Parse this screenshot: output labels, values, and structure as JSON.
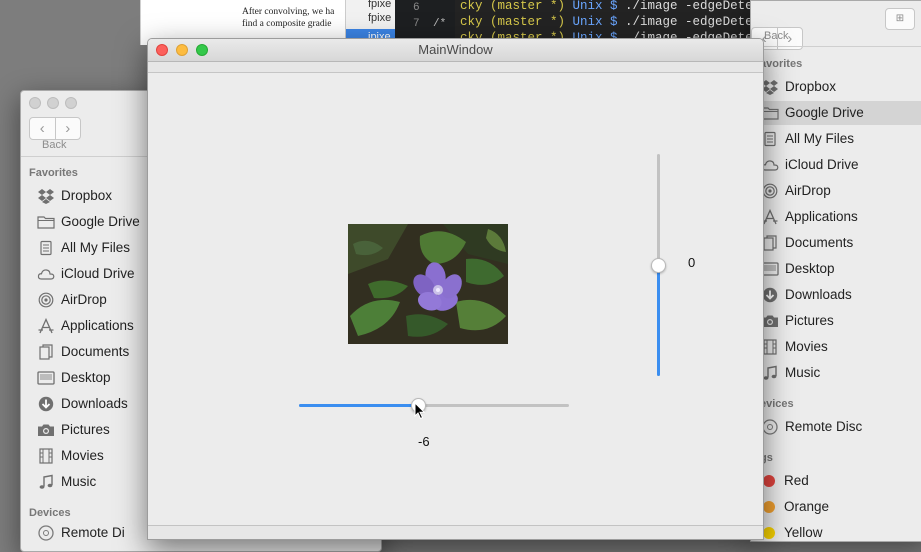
{
  "background": {
    "doc_lines": [
      "After convolving, we ha",
      "find a composite gradie"
    ],
    "ide_rows": [
      "fpixe",
      "fpixe",
      "ipixe"
    ],
    "gutter": [
      "6",
      "7"
    ],
    "terminal_lines": [
      {
        "a": "cky ",
        "b": "(master *) ",
        "c": "Unix $ ",
        "d": "./image -edgeDetect"
      },
      {
        "a": "cky ",
        "b": "(master *) ",
        "c": "Unix $ ",
        "d": "./image -edgeDetect"
      },
      {
        "a": "cky ",
        "b": "(master *) ",
        "c": "Unix $ ",
        "d": "./image -edgeDetect"
      }
    ]
  },
  "finder_left": {
    "back_label": "Back",
    "favorites_header": "Favorites",
    "items": [
      {
        "label": "Dropbox",
        "icon": "dropbox-icon"
      },
      {
        "label": "Google Drive",
        "icon": "folder-icon"
      },
      {
        "label": "All My Files",
        "icon": "all-files-icon"
      },
      {
        "label": "iCloud Drive",
        "icon": "cloud-icon"
      },
      {
        "label": "AirDrop",
        "icon": "airdrop-icon"
      },
      {
        "label": "Applications",
        "icon": "applications-icon"
      },
      {
        "label": "Documents",
        "icon": "documents-icon"
      },
      {
        "label": "Desktop",
        "icon": "desktop-icon"
      },
      {
        "label": "Downloads",
        "icon": "downloads-icon"
      },
      {
        "label": "Pictures",
        "icon": "camera-icon"
      },
      {
        "label": "Movies",
        "icon": "film-icon"
      },
      {
        "label": "Music",
        "icon": "music-icon"
      }
    ],
    "devices_header": "Devices",
    "devices_partial": "Remote Di"
  },
  "finder_right": {
    "back_label": "Back",
    "favorites_header": "avorites",
    "items": [
      {
        "label": "Dropbox",
        "icon": "dropbox-icon"
      },
      {
        "label": "Google Drive",
        "icon": "folder-icon",
        "selected": true
      },
      {
        "label": "All My Files",
        "icon": "all-files-icon"
      },
      {
        "label": "iCloud Drive",
        "icon": "cloud-icon"
      },
      {
        "label": "AirDrop",
        "icon": "airdrop-icon"
      },
      {
        "label": "Applications",
        "icon": "applications-icon"
      },
      {
        "label": "Documents",
        "icon": "documents-icon"
      },
      {
        "label": "Desktop",
        "icon": "desktop-icon"
      },
      {
        "label": "Downloads",
        "icon": "downloads-icon"
      },
      {
        "label": "Pictures",
        "icon": "camera-icon"
      },
      {
        "label": "Movies",
        "icon": "film-icon"
      },
      {
        "label": "Music",
        "icon": "music-icon"
      }
    ],
    "devices_header": "evices",
    "device_item": "Remote Disc",
    "tags_header": "gs",
    "tags": [
      {
        "label": "Red",
        "color": "#e0443e"
      },
      {
        "label": "Orange",
        "color": "#f0a030"
      },
      {
        "label": "Yellow",
        "color": "#f5d000"
      }
    ]
  },
  "main_window": {
    "title": "MainWindow",
    "h_slider": {
      "value": -6,
      "fraction": 0.44,
      "label": "-6"
    },
    "v_slider": {
      "value": 0,
      "fraction": 0.5,
      "label": "0"
    },
    "accent_color": "#3b8ef0"
  }
}
